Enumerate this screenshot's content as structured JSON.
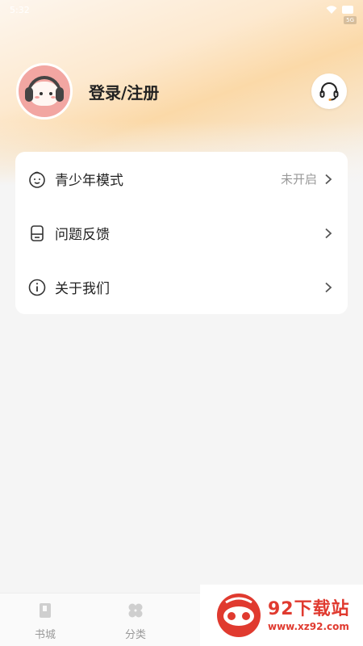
{
  "status_bar": {
    "time": "5:32",
    "badge": "5G"
  },
  "profile": {
    "login_label": "登录/注册"
  },
  "menu": {
    "items": [
      {
        "label": "青少年模式",
        "value": "未开启"
      },
      {
        "label": "问题反馈",
        "value": ""
      },
      {
        "label": "关于我们",
        "value": ""
      }
    ]
  },
  "tabbar": {
    "tabs": [
      {
        "label": "书城"
      },
      {
        "label": "分类"
      }
    ]
  },
  "watermark": {
    "title": "92下载站",
    "url": "www.xz92.com"
  },
  "colors": {
    "accent": "#e03a2f",
    "text": "#222222",
    "muted": "#999999"
  }
}
